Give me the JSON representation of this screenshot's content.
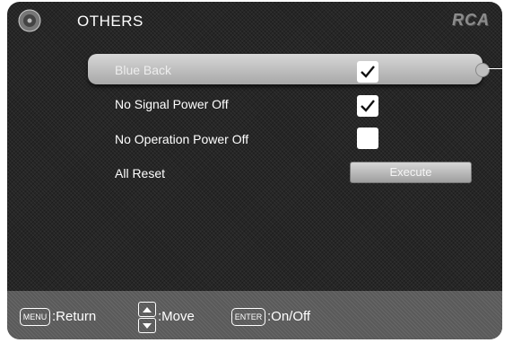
{
  "header": {
    "title": "OTHERS",
    "brand": "RCA",
    "menu_icon": "settings-disc-icon"
  },
  "rows": [
    {
      "label": "Blue Back",
      "control": "checkbox",
      "checked": true,
      "selected": true
    },
    {
      "label": "No Signal Power Off",
      "control": "checkbox",
      "checked": true,
      "selected": false
    },
    {
      "label": "No Operation Power Off",
      "control": "checkbox",
      "checked": false,
      "selected": false
    },
    {
      "label": "All Reset",
      "control": "button",
      "button_label": "Execute",
      "selected": false
    }
  ],
  "footer": {
    "menu_key": "MENU",
    "menu_text": ":Return",
    "move_text": ":Move",
    "enter_key": "ENTER",
    "enter_text": ":On/Off",
    "icons": [
      "up-arrow-icon",
      "down-arrow-icon"
    ]
  },
  "colors": {
    "background": "#262626",
    "highlight": "#c4c4c4",
    "footer": "#5a5a5a",
    "text": "#ffffff"
  }
}
